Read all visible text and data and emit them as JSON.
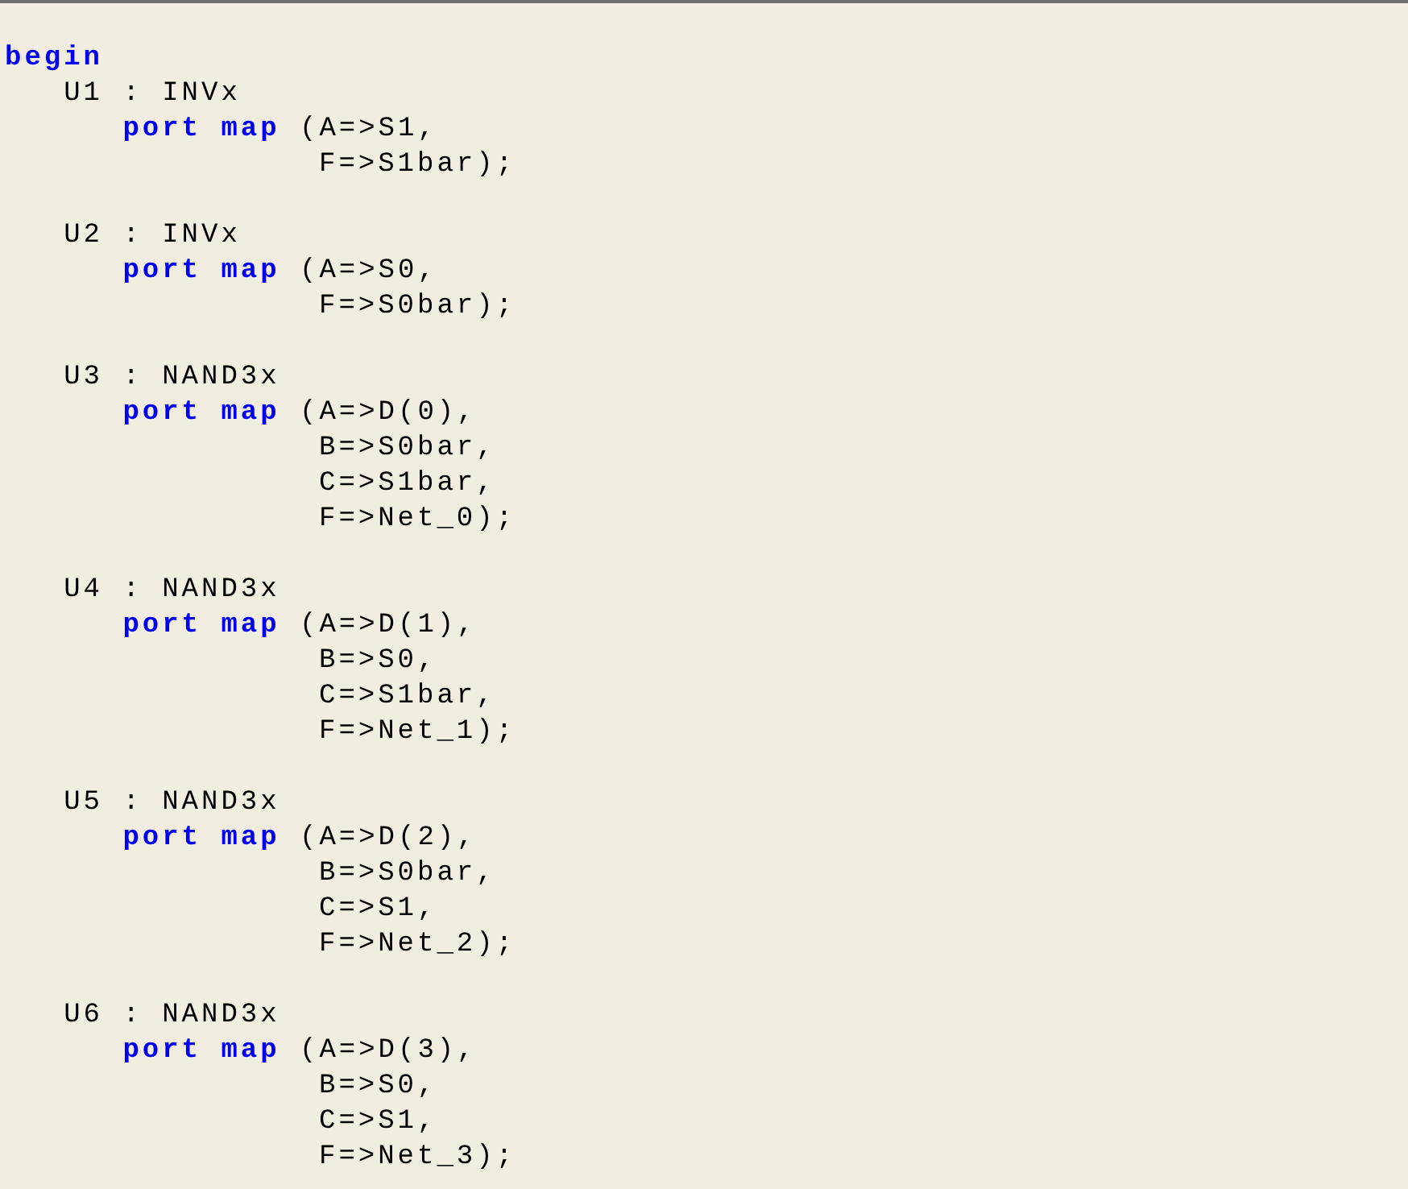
{
  "editor": {
    "lines": [
      {
        "kind": "top",
        "segments": [
          {
            "kind": "keyword",
            "text": "begin"
          }
        ]
      },
      {
        "kind": "instance",
        "segments": [
          {
            "kind": "plain",
            "text": "U1 : INVx"
          }
        ]
      },
      {
        "kind": "port",
        "segments": [
          {
            "kind": "keyword",
            "text": "port map"
          },
          {
            "kind": "plain",
            "text": "(A=>S1,"
          }
        ]
      },
      {
        "kind": "arg",
        "segments": [
          {
            "kind": "plain",
            "text": "F=>S1bar);"
          }
        ]
      },
      {
        "kind": "blank"
      },
      {
        "kind": "instance",
        "segments": [
          {
            "kind": "plain",
            "text": "U2 : INVx"
          }
        ]
      },
      {
        "kind": "port",
        "segments": [
          {
            "kind": "keyword",
            "text": "port map"
          },
          {
            "kind": "plain",
            "text": "(A=>S0,"
          }
        ]
      },
      {
        "kind": "arg",
        "segments": [
          {
            "kind": "plain",
            "text": "F=>S0bar);"
          }
        ]
      },
      {
        "kind": "blank"
      },
      {
        "kind": "instance",
        "segments": [
          {
            "kind": "plain",
            "text": "U3 : NAND3x"
          }
        ]
      },
      {
        "kind": "port",
        "segments": [
          {
            "kind": "keyword",
            "text": "port map"
          },
          {
            "kind": "plain",
            "text": "(A=>D(0),"
          }
        ]
      },
      {
        "kind": "arg",
        "segments": [
          {
            "kind": "plain",
            "text": "B=>S0bar,"
          }
        ]
      },
      {
        "kind": "arg",
        "segments": [
          {
            "kind": "plain",
            "text": "C=>S1bar,"
          }
        ]
      },
      {
        "kind": "arg",
        "segments": [
          {
            "kind": "plain",
            "text": "F=>Net_0);"
          }
        ]
      },
      {
        "kind": "blank"
      },
      {
        "kind": "instance",
        "segments": [
          {
            "kind": "plain",
            "text": "U4 : NAND3x"
          }
        ]
      },
      {
        "kind": "port",
        "segments": [
          {
            "kind": "keyword",
            "text": "port map"
          },
          {
            "kind": "plain",
            "text": "(A=>D(1),"
          }
        ]
      },
      {
        "kind": "arg",
        "segments": [
          {
            "kind": "plain",
            "text": "B=>S0,"
          }
        ]
      },
      {
        "kind": "arg",
        "segments": [
          {
            "kind": "plain",
            "text": "C=>S1bar,"
          }
        ]
      },
      {
        "kind": "arg",
        "segments": [
          {
            "kind": "plain",
            "text": "F=>Net_1);"
          }
        ]
      },
      {
        "kind": "blank"
      },
      {
        "kind": "instance",
        "segments": [
          {
            "kind": "plain",
            "text": "U5 : NAND3x"
          }
        ]
      },
      {
        "kind": "port",
        "segments": [
          {
            "kind": "keyword",
            "text": "port map"
          },
          {
            "kind": "plain",
            "text": "(A=>D(2),"
          }
        ]
      },
      {
        "kind": "arg",
        "segments": [
          {
            "kind": "plain",
            "text": "B=>S0bar,"
          }
        ]
      },
      {
        "kind": "arg",
        "segments": [
          {
            "kind": "plain",
            "text": "C=>S1,"
          }
        ]
      },
      {
        "kind": "arg",
        "segments": [
          {
            "kind": "plain",
            "text": "F=>Net_2);"
          }
        ]
      },
      {
        "kind": "blank"
      },
      {
        "kind": "instance",
        "segments": [
          {
            "kind": "plain",
            "text": "U6 : NAND3x"
          }
        ]
      },
      {
        "kind": "port",
        "segments": [
          {
            "kind": "keyword",
            "text": "port map"
          },
          {
            "kind": "plain",
            "text": "(A=>D(3),"
          }
        ]
      },
      {
        "kind": "arg",
        "segments": [
          {
            "kind": "plain",
            "text": "B=>S0,"
          }
        ]
      },
      {
        "kind": "arg",
        "segments": [
          {
            "kind": "plain",
            "text": "C=>S1,"
          }
        ]
      },
      {
        "kind": "arg",
        "segments": [
          {
            "kind": "plain",
            "text": "F=>Net_3);"
          }
        ]
      }
    ]
  }
}
